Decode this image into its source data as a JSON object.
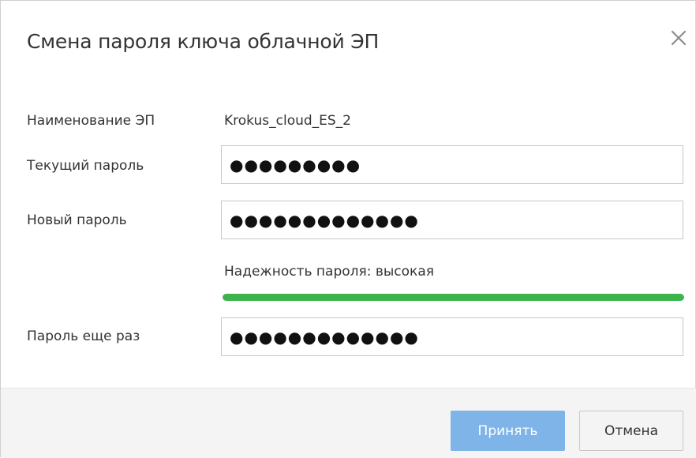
{
  "dialog": {
    "title": "Смена пароля ключа облачной ЭП",
    "close_icon": "close-icon"
  },
  "form": {
    "es_name_label": "Наименование ЭП",
    "es_name_value": "Krokus_cloud_ES_2",
    "current_password_label": "Текущий пароль",
    "current_password_value": "●●●●●●●●●",
    "new_password_label": "Новый пароль",
    "new_password_value": "●●●●●●●●●●●●●",
    "strength_label": "Надежность пароля: высокая",
    "strength_level": 1.0,
    "strength_color": "#3cb44b",
    "repeat_password_label": "Пароль еще раз",
    "repeat_password_value": "●●●●●●●●●●●●●"
  },
  "footer": {
    "accept_label": "Принять",
    "cancel_label": "Отмена",
    "accent_color": "#7eb4e8"
  }
}
